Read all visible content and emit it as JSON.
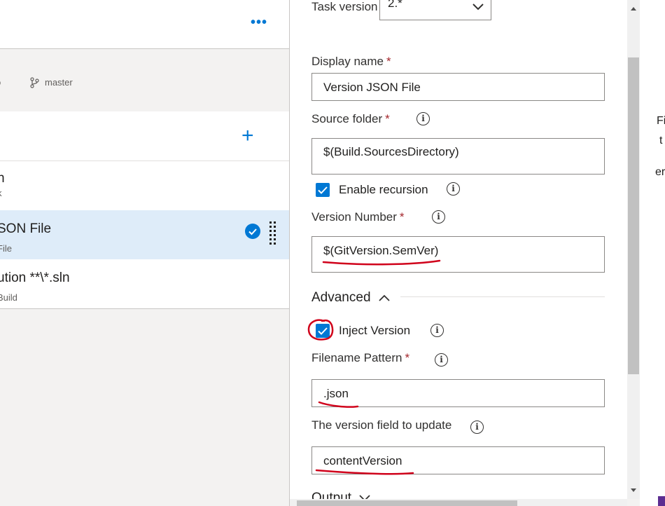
{
  "left_panel": {
    "more_label": "•••",
    "repo_prefix": "o",
    "branch": "master",
    "add_label": "+",
    "job": {
      "title": "n",
      "subtitle": "k"
    },
    "tasks": [
      {
        "title": "SON File",
        "subtitle": "File",
        "selected": true
      },
      {
        "title": "ution **\\*.sln",
        "subtitle": "Build",
        "selected": false
      }
    ]
  },
  "task_panel": {
    "task_version": {
      "label": "Task version",
      "value": "2.*"
    },
    "display_name": {
      "label": "Display name",
      "required": "*",
      "value": "Version JSON File"
    },
    "source_folder": {
      "label": "Source folder",
      "required": "*",
      "value": "$(Build.SourcesDirectory)"
    },
    "enable_recursion": {
      "label": "Enable recursion",
      "checked": true
    },
    "version_number": {
      "label": "Version Number",
      "required": "*",
      "value": "$(GitVersion.SemVer)"
    },
    "advanced": {
      "title": "Advanced",
      "expanded": true
    },
    "inject_version": {
      "label": "Inject Version",
      "checked": true
    },
    "filename_pattern": {
      "label": "Filename Pattern",
      "required": "*",
      "value": ".json"
    },
    "version_field": {
      "label": "The version field to update",
      "value": "contentVersion"
    },
    "output": {
      "title": "Output",
      "expanded": false
    },
    "info_glyph": "i"
  },
  "edge_text": {
    "line1": "Fil",
    "line2": "t",
    "line3": "er"
  },
  "colors": {
    "accent": "#0078d4",
    "selected_row": "#deecf9",
    "annotation": "#d0021b",
    "required": "#a4262c"
  }
}
